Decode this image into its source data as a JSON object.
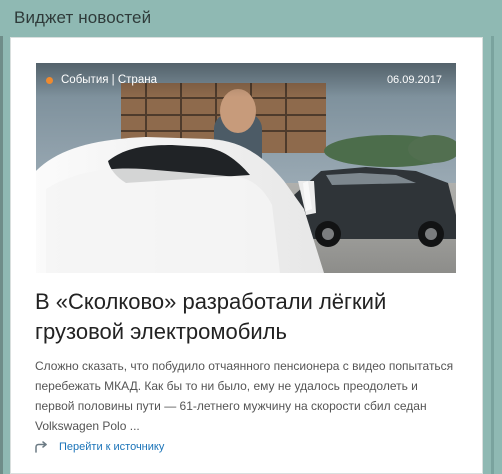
{
  "widget": {
    "title": "Виджет новостей"
  },
  "article": {
    "category": "События | Страна",
    "date": "06.09.2017",
    "headline": "В «Сколково» разработали лёгкий грузовой электромобиль",
    "excerpt": "Сложно сказать, что побудило отчаянного пенсионера с видео попытаться перебежать МКАД. Как бы то ни было, ему не удалось преодолеть и первой половины пути — 61-летнего мужчину на скорости сбил седан Volkswagen Polo ...",
    "source_link": "Перейти к источнику"
  },
  "colors": {
    "background": "#8fb9b3",
    "card": "#ffffff",
    "accent": "#1a73b8",
    "category_dot": "#ef8a2f"
  },
  "icons": {
    "category": "category-dot-icon",
    "share": "share-icon"
  }
}
